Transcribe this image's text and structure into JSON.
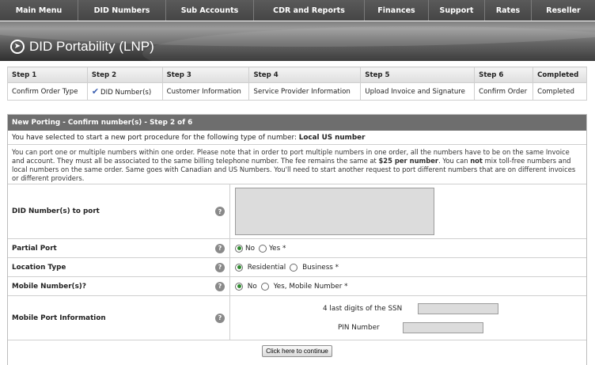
{
  "nav": [
    "Main Menu",
    "DID Numbers",
    "Sub Accounts",
    "CDR and Reports",
    "Finances",
    "Support",
    "Rates",
    "Reseller"
  ],
  "page_title": "DID Portability (LNP)",
  "steps": {
    "headers": [
      "Step 1",
      "Step 2",
      "Step 3",
      "Step 4",
      "Step 5",
      "Step 6",
      "Completed"
    ],
    "values": [
      "Confirm Order Type",
      "DID Number(s)",
      "Customer Information",
      "Service Provider Information",
      "Upload Invoice and Signature",
      "Confirm Order",
      "Completed"
    ]
  },
  "panel": {
    "header": "New Porting - Confirm number(s) - Step 2 of 6",
    "selected_prefix": "You have selected to start a new port procedure for the following type of number:",
    "selected_type": "Local US number",
    "info_1": "You can port one or multiple numbers within one order. Please note that in order to port multiple numbers in one order, all the numbers have to be on the same Invoice and account. They must all be associated to the same billing telephone number. The fee remains the same at",
    "fee": "$25 per number",
    "info_2": ". You can",
    "info_not": "not",
    "info_3": "mix toll-free numbers and local numbers on the same order. Same goes with Canadian and US Numbers. You'll need to start another request to port different numbers that are on different invoices or different providers."
  },
  "form": {
    "did_label": "DID Number(s) to port",
    "did_value": "",
    "partial_label": "Partial Port",
    "partial_no": "No",
    "partial_yes": "Yes *",
    "location_label": "Location Type",
    "location_res": "Residential",
    "location_bus": "Business *",
    "mobile_label": "Mobile Number(s)?",
    "mobile_no": "No",
    "mobile_yes": "Yes, Mobile Number *",
    "mobile_info_label": "Mobile Port Information",
    "ssn_label": "4 last digits of the SSN",
    "pin_label": "PIN Number",
    "submit": "Click here to continue",
    "help_glyph": "?"
  }
}
